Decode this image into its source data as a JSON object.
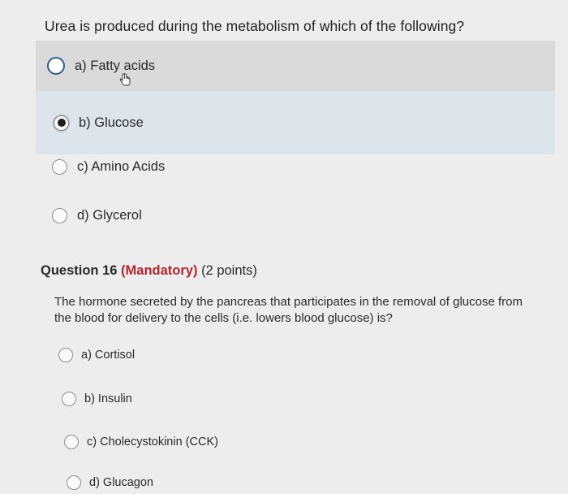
{
  "q1": {
    "question": "Urea is produced during the metabolism of which of the following?",
    "options": [
      {
        "label": "a) Fatty acids",
        "selected": false
      },
      {
        "label": "b) Glucose",
        "selected": true
      },
      {
        "label": "c) Amino Acids",
        "selected": false
      },
      {
        "label": "d) Glycerol",
        "selected": false
      }
    ]
  },
  "q16": {
    "number": "Question 16",
    "mandatory": "(Mandatory)",
    "points": "(2 points)",
    "question": "The hormone secreted by the pancreas that participates in the removal of glucose from the blood for delivery to the cells (i.e. lowers blood glucose) is?",
    "options": [
      {
        "label": "a) Cortisol"
      },
      {
        "label": "b) Insulin"
      },
      {
        "label": "c) Cholecystokinin (CCK)"
      },
      {
        "label": "d) Glucagon"
      }
    ]
  },
  "colors": {
    "background": "#ededee",
    "hover_row": "#dadadb",
    "selected_row": "#dde4ea",
    "mandatory": "#b3262e"
  },
  "icons": {
    "cursor": "hand-pointer-icon"
  }
}
